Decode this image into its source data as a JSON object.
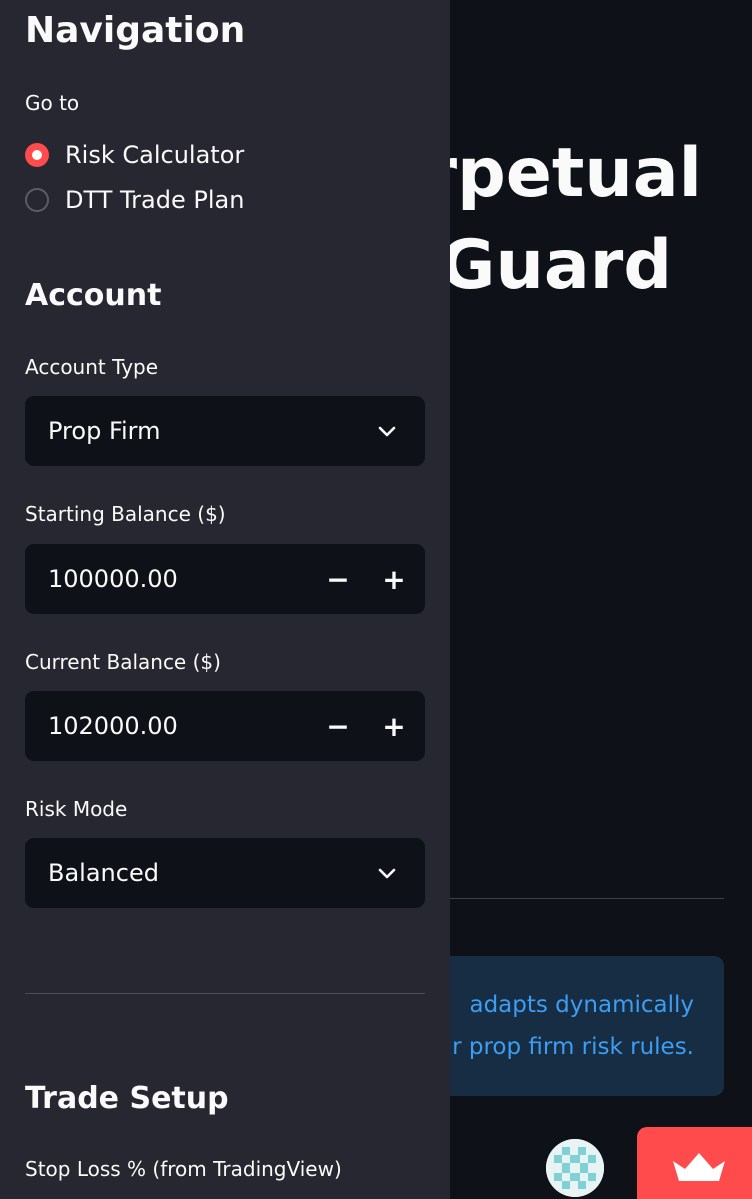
{
  "main": {
    "title_line1": "rpetual",
    "title_line2": "Guard",
    "info_line1": "adapts dynamically",
    "info_line2": "r prop firm risk rules."
  },
  "sidebar": {
    "navigation_title": "Navigation",
    "goto_label": "Go to",
    "nav_options": [
      {
        "label": "Risk Calculator",
        "selected": true
      },
      {
        "label": "DTT Trade Plan",
        "selected": false
      }
    ],
    "account_title": "Account",
    "account_type_label": "Account Type",
    "account_type_value": "Prop Firm",
    "starting_balance_label": "Starting Balance ($)",
    "starting_balance_value": "100000.00",
    "current_balance_label": "Current Balance ($)",
    "current_balance_value": "102000.00",
    "risk_mode_label": "Risk Mode",
    "risk_mode_value": "Balanced",
    "stepper_minus": "−",
    "stepper_plus": "+",
    "trade_setup_title": "Trade Setup",
    "stop_loss_label": "Stop Loss % (from TradingView)"
  },
  "icons": {
    "dropdown": "chevron-down-icon",
    "avatar": "avatar-pattern-icon",
    "badge": "crown-icon"
  },
  "colors": {
    "accent": "#ff4b4b",
    "sidebar_bg": "#262730",
    "main_bg": "#0e1117",
    "info_bg": "#172d43",
    "info_text": "#3d9df3"
  }
}
